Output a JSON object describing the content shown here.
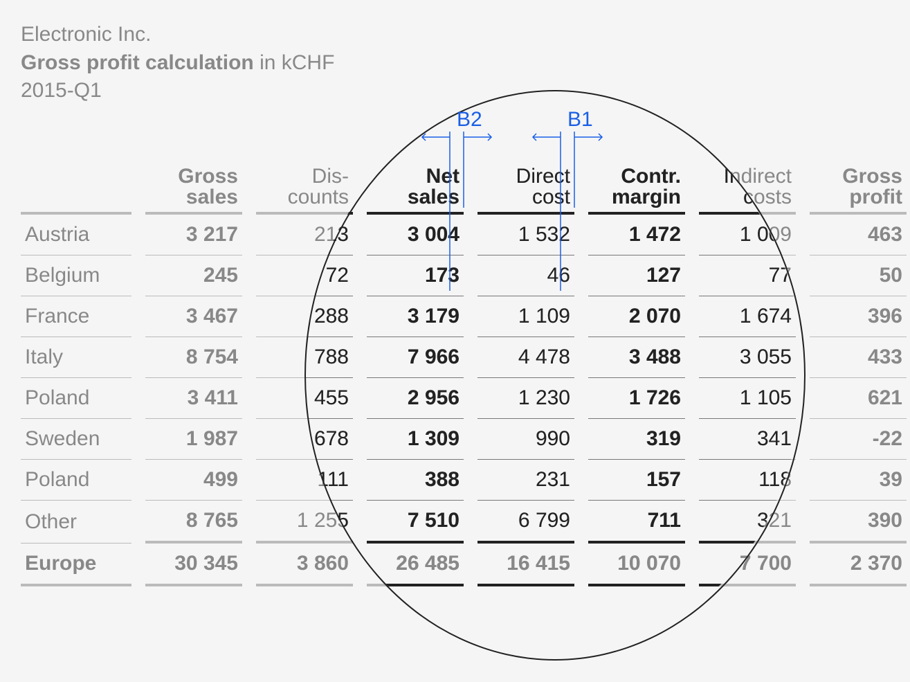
{
  "title": {
    "company": "Electronic Inc.",
    "main_bold": "Gross profit calculation",
    "main_rest": " in kCHF",
    "period": "2015-Q1"
  },
  "annotations": {
    "b1": "B1",
    "b2": "B2"
  },
  "columns": [
    {
      "key": "gross_sales",
      "label": "Gross\nsales",
      "bold": true
    },
    {
      "key": "discounts",
      "label": "Dis-\ncounts",
      "bold": false
    },
    {
      "key": "net_sales",
      "label": "Net\nsales",
      "bold": true
    },
    {
      "key": "direct_cost",
      "label": "Direct\ncost",
      "bold": false
    },
    {
      "key": "contr_margin",
      "label": "Contr.\nmargin",
      "bold": true
    },
    {
      "key": "indirect_costs",
      "label": "Indirect\ncosts",
      "bold": false
    },
    {
      "key": "gross_profit",
      "label": "Gross\nprofit",
      "bold": true
    }
  ],
  "rows": [
    {
      "label": "Austria",
      "gross_sales": "3 217",
      "discounts": "213",
      "net_sales": "3 004",
      "direct_cost": "1 532",
      "contr_margin": "1 472",
      "indirect_costs": "1 009",
      "gross_profit": "463"
    },
    {
      "label": "Belgium",
      "gross_sales": "245",
      "discounts": "72",
      "net_sales": "173",
      "direct_cost": "46",
      "contr_margin": "127",
      "indirect_costs": "77",
      "gross_profit": "50"
    },
    {
      "label": "France",
      "gross_sales": "3 467",
      "discounts": "288",
      "net_sales": "3 179",
      "direct_cost": "1 109",
      "contr_margin": "2 070",
      "indirect_costs": "1 674",
      "gross_profit": "396"
    },
    {
      "label": "Italy",
      "gross_sales": "8 754",
      "discounts": "788",
      "net_sales": "7 966",
      "direct_cost": "4 478",
      "contr_margin": "3 488",
      "indirect_costs": "3 055",
      "gross_profit": "433"
    },
    {
      "label": "Poland",
      "gross_sales": "3 411",
      "discounts": "455",
      "net_sales": "2 956",
      "direct_cost": "1 230",
      "contr_margin": "1 726",
      "indirect_costs": "1 105",
      "gross_profit": "621"
    },
    {
      "label": "Sweden",
      "gross_sales": "1 987",
      "discounts": "678",
      "net_sales": "1 309",
      "direct_cost": "990",
      "contr_margin": "319",
      "indirect_costs": "341",
      "gross_profit": "-22"
    },
    {
      "label": "Poland",
      "gross_sales": "499",
      "discounts": "111",
      "net_sales": "388",
      "direct_cost": "231",
      "contr_margin": "157",
      "indirect_costs": "118",
      "gross_profit": "39"
    },
    {
      "label": "Other",
      "gross_sales": "8 765",
      "discounts": "1 255",
      "net_sales": "7 510",
      "direct_cost": "6 799",
      "contr_margin": "711",
      "indirect_costs": "321",
      "gross_profit": "390"
    }
  ],
  "total": {
    "label": "Europe",
    "gross_sales": "30 345",
    "discounts": "3 860",
    "net_sales": "26 485",
    "direct_cost": "16 415",
    "contr_margin": "10 070",
    "indirect_costs": "7 700",
    "gross_profit": "2 370"
  },
  "chart_data": {
    "type": "table",
    "title": "Gross profit calculation in kCHF",
    "subtitle": "Electronic Inc. — 2015-Q1",
    "columns": [
      "Gross sales",
      "Discounts",
      "Net sales",
      "Direct cost",
      "Contr. margin",
      "Indirect costs",
      "Gross profit"
    ],
    "categories": [
      "Austria",
      "Belgium",
      "France",
      "Italy",
      "Poland",
      "Sweden",
      "Poland",
      "Other",
      "Europe"
    ],
    "series": [
      {
        "name": "Gross sales",
        "values": [
          3217,
          245,
          3467,
          8754,
          3411,
          1987,
          499,
          8765,
          30345
        ]
      },
      {
        "name": "Discounts",
        "values": [
          213,
          72,
          288,
          788,
          455,
          678,
          111,
          1255,
          3860
        ]
      },
      {
        "name": "Net sales",
        "values": [
          3004,
          173,
          3179,
          7966,
          2956,
          1309,
          388,
          7510,
          26485
        ]
      },
      {
        "name": "Direct cost",
        "values": [
          1532,
          46,
          1109,
          4478,
          1230,
          990,
          231,
          6799,
          16415
        ]
      },
      {
        "name": "Contr. margin",
        "values": [
          1472,
          127,
          2070,
          3488,
          1726,
          319,
          157,
          711,
          10070
        ]
      },
      {
        "name": "Indirect costs",
        "values": [
          1009,
          77,
          1674,
          3055,
          1105,
          341,
          118,
          321,
          7700
        ]
      },
      {
        "name": "Gross profit",
        "values": [
          463,
          50,
          396,
          433,
          621,
          -22,
          39,
          390,
          2370
        ]
      }
    ],
    "annotations": [
      "B1 = gap between Direct cost and Contr. margin columns",
      "B2 = gap between Net sales and Direct cost columns"
    ]
  }
}
